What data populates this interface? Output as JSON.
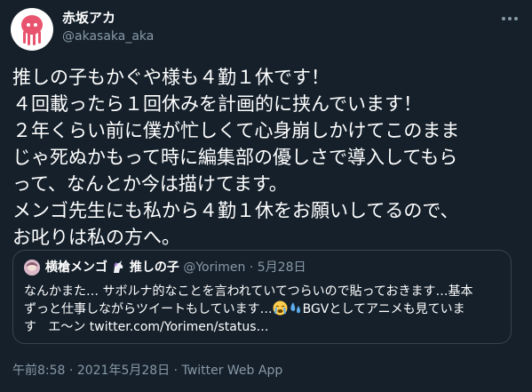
{
  "author": {
    "display_name": "赤坂アカ",
    "handle": "@akasaka_aka",
    "avatar_icon": "octopus-icon"
  },
  "tweet": {
    "lines": [
      "推しの子もかぐや様も４勤１休です！",
      "４回載ったら１回休みを計画的に挟んでいます！",
      "２年くらい前に僕が忙しくて心身崩しかけてこのまま",
      "じゃ死ぬかもって時に編集部の優しさで導入してもら",
      "って、なんとか今は描けてます。",
      "メンゴ先生にも私から４勤１休をお願いしてるので、",
      "お叱りは私の方へ。"
    ]
  },
  "quote": {
    "display_name": "横槍メンゴ",
    "name_suffix": "推しの子",
    "handle": "@Yorimen",
    "separator": "·",
    "date": "5月28日",
    "line1": "なんかまた… サボルナ的なことを言われていてつらいので貼っておきます…基本",
    "line2_a": "ずっと仕事しながらツイートもしています…",
    "line2_b": "BGVとしてアニメも見ていま",
    "line3_a": "す",
    "line3_b": "エ〜ン twitter.com/Yorimen/status…",
    "emojis": [
      "crying-face-icon",
      "sweat-droplets-icon"
    ]
  },
  "meta": {
    "time": "午前8:58",
    "separator": "·",
    "date": "2021年5月28日",
    "source": "Twitter Web App"
  },
  "colors": {
    "background": "#15202b",
    "text": "#ffffff",
    "muted": "#8899a6",
    "border": "#38444d"
  }
}
